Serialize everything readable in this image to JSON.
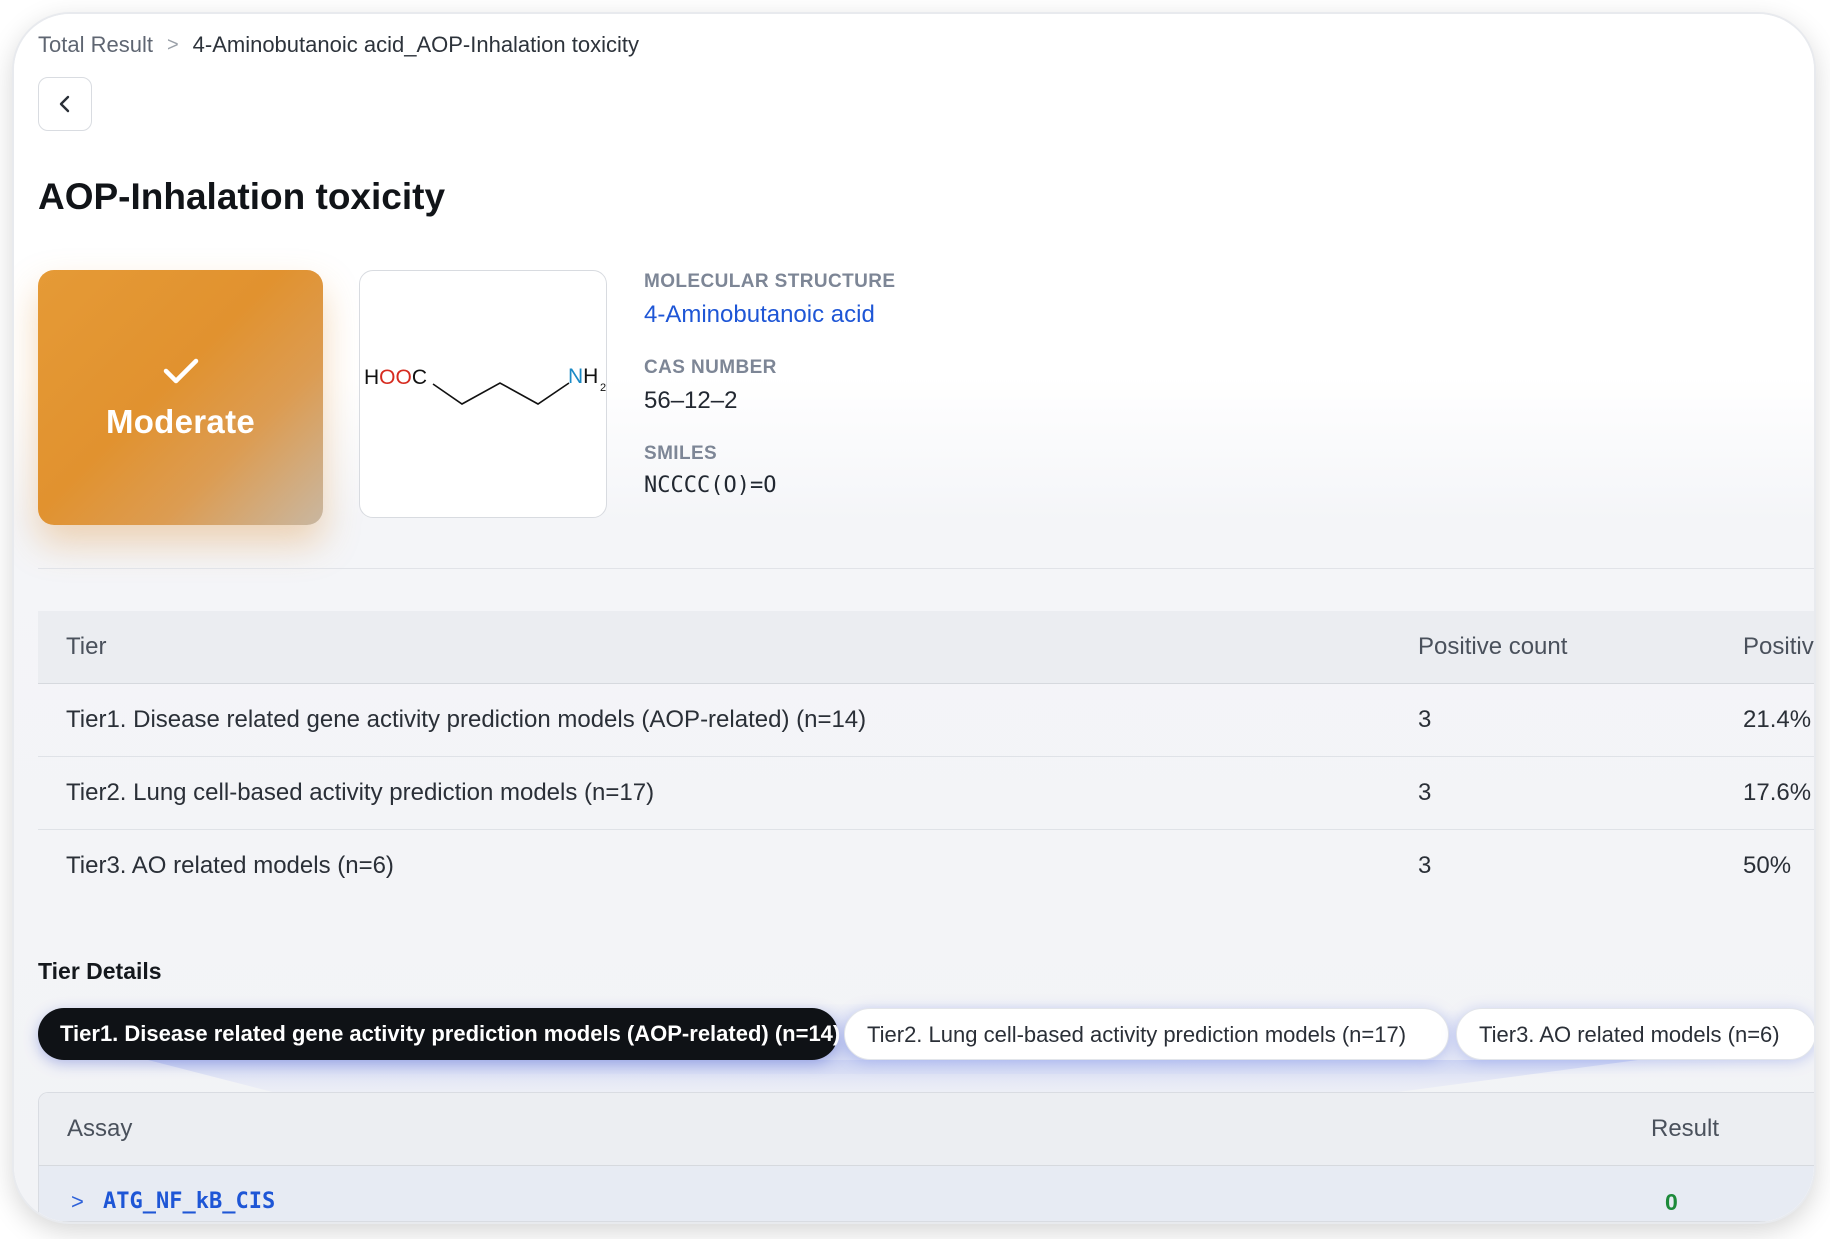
{
  "breadcrumb": {
    "root": "Total Result",
    "separator": ">",
    "current": "4-Aminobutanoic acid_AOP-Inhalation toxicity"
  },
  "back_icon": "chevron-left-icon",
  "page_title": "AOP-Inhalation toxicity",
  "result_card": {
    "icon": "check-icon",
    "label": "Moderate",
    "color": "#E3962F"
  },
  "molecule": {
    "structure_label": "MOLECULAR STRUCTURE",
    "name": "4-Aminobutanoic acid",
    "cas_label": "CAS NUMBER",
    "cas": "56–12–2",
    "smiles_label": "SMILES",
    "smiles": "NCCCC(O)=O",
    "drawing": {
      "left_group_h": "H",
      "left_group_oo": "OO",
      "left_group_c": "C",
      "right_group_n": "N",
      "right_group_h": "H",
      "right_group_sub": "2"
    }
  },
  "tier_table": {
    "columns": [
      "Tier",
      "Positive count",
      "Positive"
    ],
    "rows": [
      {
        "tier": "Tier1. Disease related gene activity prediction models (AOP-related) (n=14)",
        "count": "3",
        "pct": "21.4%"
      },
      {
        "tier": "Tier2. Lung cell-based activity prediction models (n=17)",
        "count": "3",
        "pct": "17.6%"
      },
      {
        "tier": "Tier3. AO related models (n=6)",
        "count": "3",
        "pct": "50%"
      }
    ]
  },
  "tier_details": {
    "title": "Tier Details",
    "tabs": [
      {
        "label": "Tier1. Disease related gene activity prediction models (AOP-related) (n=14)",
        "active": true
      },
      {
        "label": "Tier2. Lung cell-based activity prediction models (n=17)",
        "active": false
      },
      {
        "label": "Tier3. AO related models (n=6)",
        "active": false
      }
    ]
  },
  "assay_table": {
    "columns": [
      "Assay",
      "Result"
    ],
    "rows": [
      {
        "expand_icon": "chevron-right-icon",
        "expand_glyph": ">",
        "assay": "ATG_NF_kB_CIS",
        "result": "0"
      }
    ]
  },
  "colors": {
    "accent_link": "#1E56D6",
    "result_positive_zero": "#1D8A3A",
    "active_tab": "#0F1216"
  }
}
